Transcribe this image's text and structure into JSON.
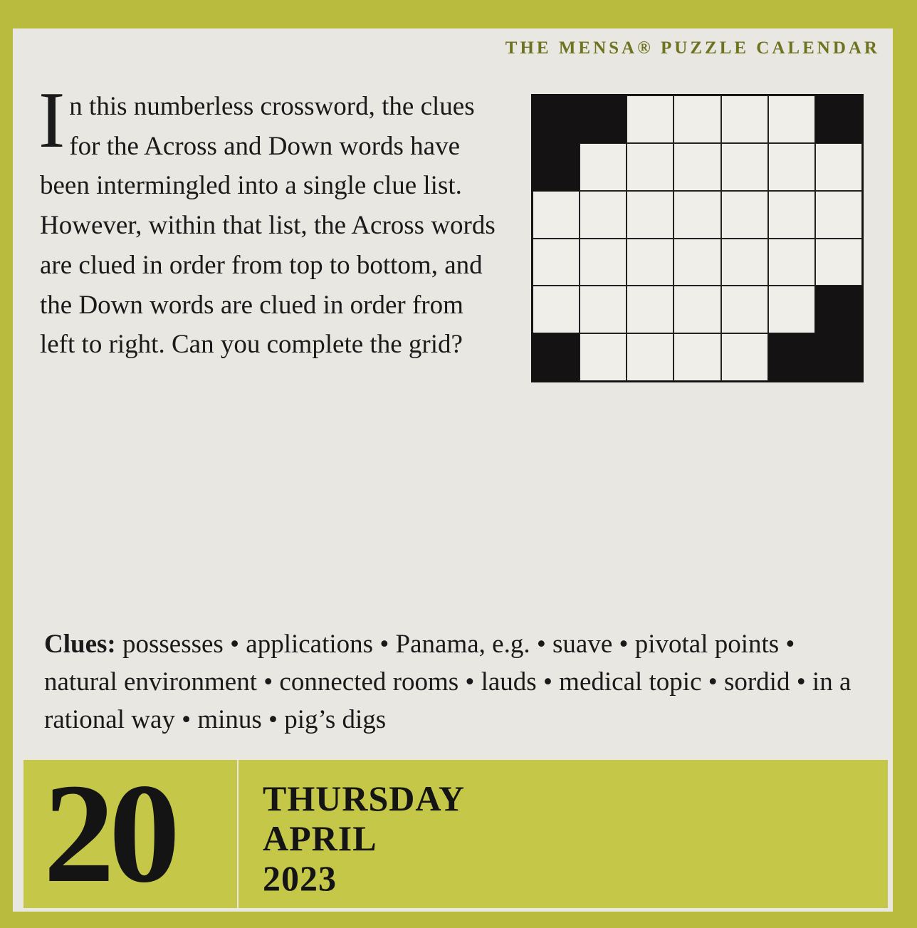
{
  "brand": "THE MENSA® PUZZLE CALENDAR",
  "intro": {
    "dropcap": "I",
    "text": "n this numberless crossword, the clues for the Across and Down words have been intermingled into a single clue list. However, within that list, the Across words are clued in order from top to bottom, and the Down words are clued in order from left to right. Can you complete the grid?"
  },
  "grid": {
    "rows": [
      [
        1,
        1,
        0,
        0,
        0,
        0,
        1
      ],
      [
        1,
        0,
        0,
        0,
        0,
        0,
        0
      ],
      [
        0,
        0,
        0,
        0,
        0,
        0,
        0
      ],
      [
        0,
        0,
        0,
        0,
        0,
        0,
        0
      ],
      [
        0,
        0,
        0,
        0,
        0,
        0,
        1
      ],
      [
        1,
        0,
        0,
        0,
        0,
        1,
        1
      ]
    ]
  },
  "clues": {
    "label": "Clues:",
    "text": " possesses • applications • Panama, e.g. • suave • pivotal points • natural environment • connected rooms • lauds • medical topic • sordid • in a rational way • minus • pig’s digs"
  },
  "date": {
    "day": "20",
    "weekday": "THURSDAY",
    "month": "APRIL",
    "year": "2023"
  },
  "colors": {
    "background": "#b9bb3f",
    "paper": "#e9e7e2",
    "brand_text": "#6f7320",
    "block": "#141212"
  }
}
